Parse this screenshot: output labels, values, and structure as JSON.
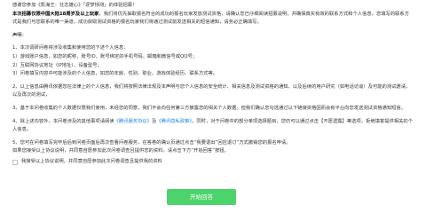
{
  "notice": {
    "intro_1": "感谢您参加《凯海王：壮志雄心》「逐梦惊测」的体验招募！",
    "intro_2a": "本次招募仅限中国大陆18周岁及以上玩家",
    "intro_2b": "，我们将优先抽取报名符合的成功的报名玩家发放测试资格，请确认您已仔细阅读招募说明，并确保真实有效的联系方式和个人信息，您填写的联系方式是我们与您联系的唯一渠道，成功获取测试资格的报名玩家我们将通过测试前发送相关的短信通知，请务必正确填写。",
    "statement_title": "声明：",
    "item_1": "1、本次调研问卷将涉及收集和使用您的下述个人信息：",
    "item_1_1": "1）游戏账户信息，如您的昵称、账号ID、账号绑定的手机号码、邮箱和微信号或QQ号；",
    "item_1_2": "2）互联网协议地址（IP地址）、设备型号；",
    "item_1_3": "3）问卷填写内容中可能涉及的个人信息，如您的年龄、性别、职业、游戏体验经历、联系方式等。",
    "item_2": "2、以上信息由腾讯依据您在法律上的个人信息，我们将按照法律法规及本声明与您个人信息的安全统计、相关信息及测试资格的通知、以及后续的用户研究（如电话访谈）及可能的测试邀请，以及再次的测试，",
    "item_3": "3、基于本问卷收集的个人数据仅限我们使用，未经您的同意，我们不会向任何第三方披露您的相关个人数据。但我们确认您勾选通过以下链接资格因而会有平台向您发送测试资格通知短信。",
    "item_4a": "4、除上述内容外，本问卷涉及的其他事项请阅读",
    "link_guide": "《腾讯服务协议》",
    "item_4b": "及",
    "link_privacy": "《腾讯隐私政策》",
    "item_4c": "，同时，对于问卷中的部分单项选择题目，您仍可以通过点击【不愿透露】等选项，拒绝填答提供相关的个人信息。",
    "item_5": "5、您可在问卷填写完毕后后到问卷页面后再次查看问卷服务，在答卷的确认页通过点击“我要退出”回应退订“方式撤销您的报名申请。",
    "item_6": "如果您接受以上协议说明，并同意自愿参加此次问卷调查且提供您的资料，请点击下方“开始回答”按钮。",
    "agree_label": "我接受以上协议说明，并同意自愿参加此次问卷调查且提供我的资料",
    "start_button": "开始回答"
  },
  "colors": {
    "highlight": "#e53935",
    "link": "#1e88e5",
    "button": "#4dd36b"
  }
}
